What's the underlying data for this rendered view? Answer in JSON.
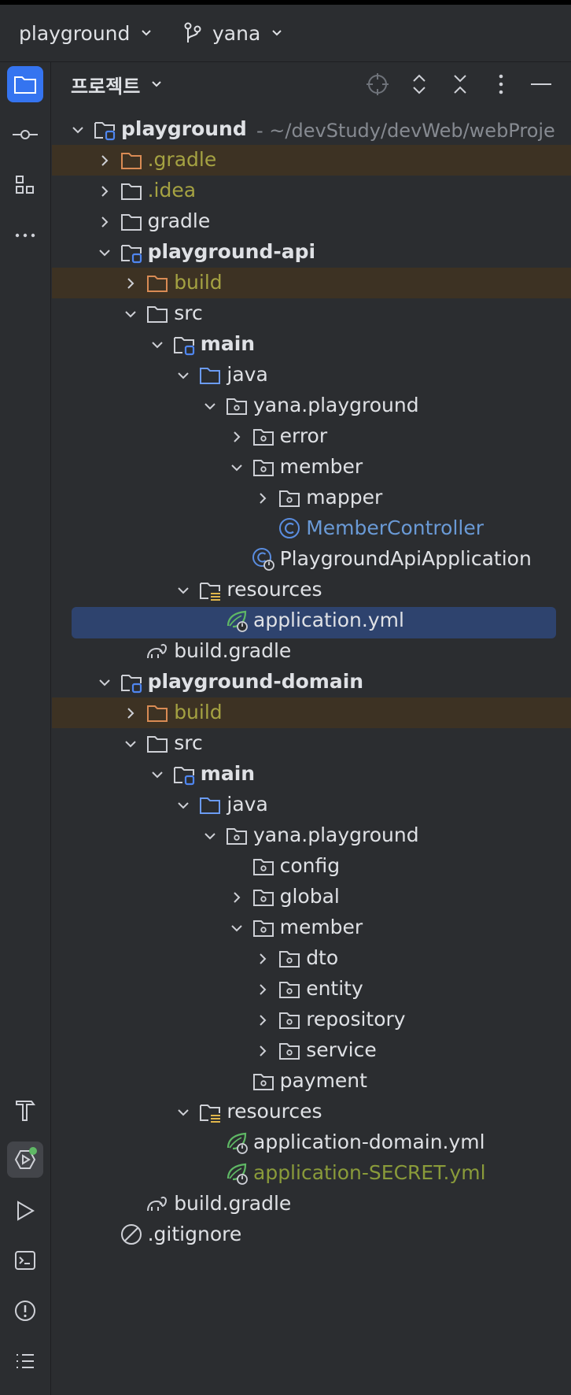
{
  "topbar": {
    "project": "playground",
    "branch": "yana"
  },
  "panel": {
    "title": "프로젝트"
  },
  "sidebar": {
    "icons": [
      "folder-icon",
      "commit-icon",
      "structure-icon",
      "more-icon"
    ],
    "bottom_icons": [
      "hammer-icon",
      "services-icon",
      "run-icon",
      "terminal-icon",
      "problems-icon",
      "todo-icon"
    ]
  },
  "tree": [
    {
      "depth": 0,
      "arrow": "down",
      "icon": "module",
      "label": "playground",
      "path": " - ~/devStudy/devWeb/webProje",
      "bold": true
    },
    {
      "depth": 1,
      "arrow": "right",
      "icon": "folder-excluded",
      "label": ".gradle",
      "style": "excluded",
      "row": "excluded"
    },
    {
      "depth": 1,
      "arrow": "right",
      "icon": "folder",
      "label": ".idea",
      "style": "excluded"
    },
    {
      "depth": 1,
      "arrow": "right",
      "icon": "folder",
      "label": "gradle"
    },
    {
      "depth": 1,
      "arrow": "down",
      "icon": "module",
      "label": "playground-api",
      "bold": true
    },
    {
      "depth": 2,
      "arrow": "right",
      "icon": "folder-excluded",
      "label": "build",
      "style": "excluded",
      "row": "excluded"
    },
    {
      "depth": 2,
      "arrow": "down",
      "icon": "folder",
      "label": "src"
    },
    {
      "depth": 3,
      "arrow": "down",
      "icon": "module",
      "label": "main",
      "bold": true
    },
    {
      "depth": 4,
      "arrow": "down",
      "icon": "folder-source",
      "label": "java"
    },
    {
      "depth": 5,
      "arrow": "down",
      "icon": "package",
      "label": "yana.playground"
    },
    {
      "depth": 6,
      "arrow": "right",
      "icon": "package",
      "label": "error"
    },
    {
      "depth": 6,
      "arrow": "down",
      "icon": "package",
      "label": "member"
    },
    {
      "depth": 7,
      "arrow": "right",
      "icon": "package",
      "label": "mapper"
    },
    {
      "depth": 7,
      "arrow": "none",
      "icon": "class",
      "label": "MemberController",
      "style": "classc"
    },
    {
      "depth": 6,
      "arrow": "none",
      "icon": "spring-boot-class",
      "label": "PlaygroundApiApplication"
    },
    {
      "depth": 4,
      "arrow": "down",
      "icon": "folder-resources",
      "label": "resources"
    },
    {
      "depth": 5,
      "arrow": "none",
      "icon": "spring-yml",
      "label": "application.yml",
      "row": "selected"
    },
    {
      "depth": 2,
      "arrow": "none",
      "icon": "gradle",
      "label": "build.gradle"
    },
    {
      "depth": 1,
      "arrow": "down",
      "icon": "module",
      "label": "playground-domain",
      "bold": true
    },
    {
      "depth": 2,
      "arrow": "right",
      "icon": "folder-excluded",
      "label": "build",
      "style": "excluded",
      "row": "excluded"
    },
    {
      "depth": 2,
      "arrow": "down",
      "icon": "folder",
      "label": "src"
    },
    {
      "depth": 3,
      "arrow": "down",
      "icon": "module",
      "label": "main",
      "bold": true
    },
    {
      "depth": 4,
      "arrow": "down",
      "icon": "folder-source",
      "label": "java"
    },
    {
      "depth": 5,
      "arrow": "down",
      "icon": "package",
      "label": "yana.playground"
    },
    {
      "depth": 6,
      "arrow": "none",
      "icon": "package",
      "label": "config"
    },
    {
      "depth": 6,
      "arrow": "right",
      "icon": "package",
      "label": "global"
    },
    {
      "depth": 6,
      "arrow": "down",
      "icon": "package",
      "label": "member"
    },
    {
      "depth": 7,
      "arrow": "right",
      "icon": "package",
      "label": "dto"
    },
    {
      "depth": 7,
      "arrow": "right",
      "icon": "package",
      "label": "entity"
    },
    {
      "depth": 7,
      "arrow": "right",
      "icon": "package",
      "label": "repository"
    },
    {
      "depth": 7,
      "arrow": "right",
      "icon": "package",
      "label": "service"
    },
    {
      "depth": 6,
      "arrow": "none",
      "icon": "package",
      "label": "payment"
    },
    {
      "depth": 4,
      "arrow": "down",
      "icon": "folder-resources",
      "label": "resources"
    },
    {
      "depth": 5,
      "arrow": "none",
      "icon": "spring-yml",
      "label": "application-domain.yml"
    },
    {
      "depth": 5,
      "arrow": "none",
      "icon": "spring-yml",
      "label": "application-SECRET.yml",
      "style": "secret"
    },
    {
      "depth": 2,
      "arrow": "none",
      "icon": "gradle",
      "label": "build.gradle"
    },
    {
      "depth": 1,
      "arrow": "none",
      "icon": "ignore",
      "label": ".gitignore"
    }
  ]
}
